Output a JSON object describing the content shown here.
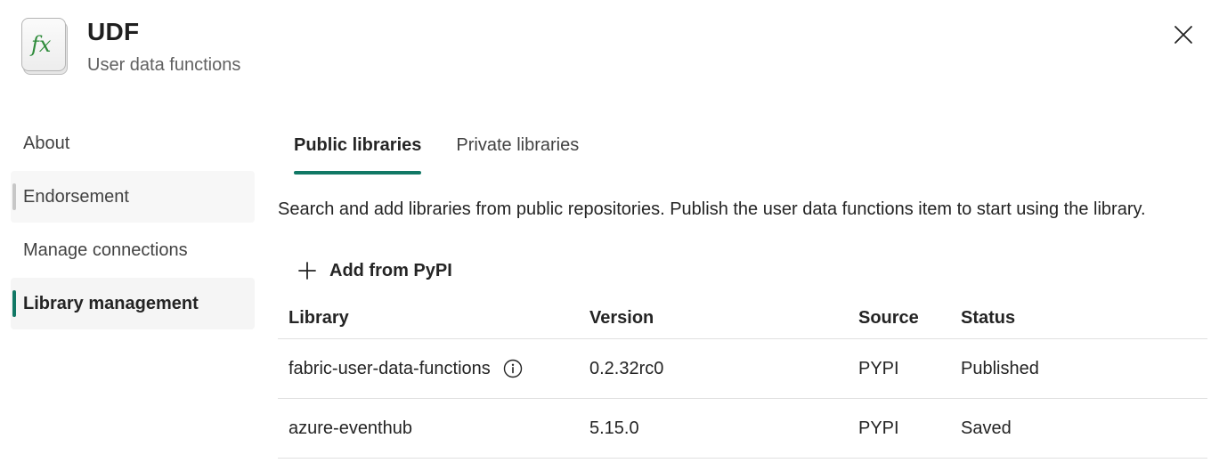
{
  "header": {
    "title": "UDF",
    "subtitle": "User data functions",
    "icon": "fx-function-icon",
    "icon_glyph": "fx",
    "icon_color": "#2e8b3a"
  },
  "sidebar": {
    "items": [
      {
        "label": "About",
        "state": "normal"
      },
      {
        "label": "Endorsement",
        "state": "hovered"
      },
      {
        "label": "Manage connections",
        "state": "normal"
      },
      {
        "label": "Library management",
        "state": "active"
      }
    ]
  },
  "tabs": [
    {
      "label": "Public libraries",
      "active": true
    },
    {
      "label": "Private libraries",
      "active": false
    }
  ],
  "description": "Search and add libraries from public repositories. Publish the user data functions item to start using the library.",
  "add_button": {
    "label": "Add from PyPI",
    "icon": "plus-icon"
  },
  "table": {
    "headers": {
      "library": "Library",
      "version": "Version",
      "source": "Source",
      "status": "Status"
    },
    "rows": [
      {
        "library": "fabric-user-data-functions",
        "info": true,
        "version": "0.2.32rc0",
        "source": "PYPI",
        "status": "Published"
      },
      {
        "library": "azure-eventhub",
        "info": false,
        "version": "5.15.0",
        "source": "PYPI",
        "status": "Saved"
      }
    ]
  },
  "colors": {
    "accent": "#117865"
  }
}
